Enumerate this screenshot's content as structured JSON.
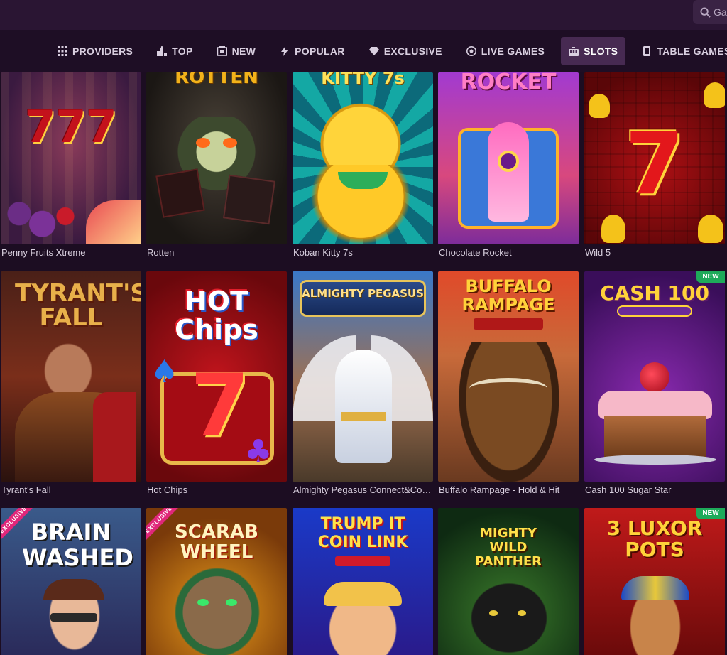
{
  "search": {
    "placeholder": "Ga"
  },
  "nav": [
    {
      "label": "PROVIDERS",
      "icon": "grid-icon"
    },
    {
      "label": "TOP",
      "icon": "podium-icon"
    },
    {
      "label": "NEW",
      "icon": "new-icon"
    },
    {
      "label": "POPULAR",
      "icon": "bolt-icon"
    },
    {
      "label": "EXCLUSIVE",
      "icon": "diamond-icon"
    },
    {
      "label": "LIVE GAMES",
      "icon": "chip-icon"
    },
    {
      "label": "SLOTS",
      "icon": "slot-machine-icon",
      "active": true
    },
    {
      "label": "TABLE GAMES",
      "icon": "cards-icon"
    }
  ],
  "games": [
    {
      "title": "Penny Fruits Xtreme",
      "art": "777"
    },
    {
      "title": "Rotten",
      "art": "ROTTEN"
    },
    {
      "title": "Koban Kitty 7s",
      "art": "KITTY 7s"
    },
    {
      "title": "Chocolate Rocket",
      "art": "ROCKET"
    },
    {
      "title": "Wild 5",
      "art": "7"
    },
    {
      "title": "Tyrant's Fall",
      "art": "TYRANT'S FALL"
    },
    {
      "title": "Hot Chips",
      "art": "HOT Chips"
    },
    {
      "title": "Almighty Pegasus Connect&Collect",
      "art": "ALMIGHTY PEGASUS"
    },
    {
      "title": "Buffalo Rampage - Hold & Hit",
      "art": "BUFFALO RAMPAGE"
    },
    {
      "title": "Cash 100 Sugar Star",
      "art": "CASH 100",
      "badge": "NEW"
    },
    {
      "title": "Brain Washed",
      "art": "BRAIN WASHED",
      "badge": "EXCLUSIVE"
    },
    {
      "title": "Scarab Wheel",
      "art": "SCARAB WHEEL",
      "badge": "EXCLUSIVE"
    },
    {
      "title": "Trump It Coin Link",
      "art": "TRUMP IT COIN LINK"
    },
    {
      "title": "Mighty Wild Panther",
      "art": "MIGHTY WILD PANTHER"
    },
    {
      "title": "3 Luxor Pots",
      "art": "3 LUXOR POTS",
      "badge": "NEW"
    }
  ],
  "colors": {
    "background": "#1c0d22",
    "nav_active": "#472a52",
    "badge_new": "#1eaa5a",
    "badge_exclusive": "#e0277a"
  }
}
